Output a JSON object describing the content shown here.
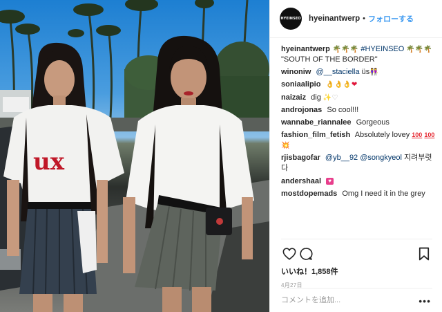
{
  "post": {
    "username": "hyeinantwerp",
    "avatar_text": "HYEINSEO",
    "follow_label": "フォローする",
    "separator": "•",
    "caption": {
      "username": "hyeinantwerp",
      "text_after_palms": "#HYEINSEO",
      "text_second_line": "\"SOUTH OF THE BORDER\""
    },
    "comments": [
      {
        "user": "winoniw",
        "mention": "@__staciella",
        "text": "üs"
      },
      {
        "user": "soniaalipio",
        "text": ""
      },
      {
        "user": "naizaiz",
        "text": "dig"
      },
      {
        "user": "androjonas",
        "text": "So cool!!!"
      },
      {
        "user": "wannabe_riannalee",
        "text": "Gorgeous"
      },
      {
        "user": "fashion_film_fetish",
        "text": "Absolutely lovey"
      },
      {
        "user": "rjisbagofar",
        "mention": "@yb__92",
        "mention2": "@songkyeol",
        "text": "지려부렷다"
      },
      {
        "user": "andershaal",
        "text": ""
      },
      {
        "user": "mostdopemads",
        "text": "Omg I need it in the grey"
      }
    ],
    "likes_text": "いいね！1,858件",
    "date_text": "4月27日",
    "add_comment_placeholder": "コメントを追加...",
    "more_label": "•••",
    "photo_shirt_text": "ux"
  },
  "icons": {
    "like": "heart-icon",
    "comment": "comment-bubble-icon",
    "save": "bookmark-icon",
    "more": "more-options-icon"
  },
  "colors": {
    "follow_blue": "#3897f0",
    "mention_blue": "#003569",
    "text": "#262626",
    "muted": "#999999",
    "divider": "#efefef"
  }
}
